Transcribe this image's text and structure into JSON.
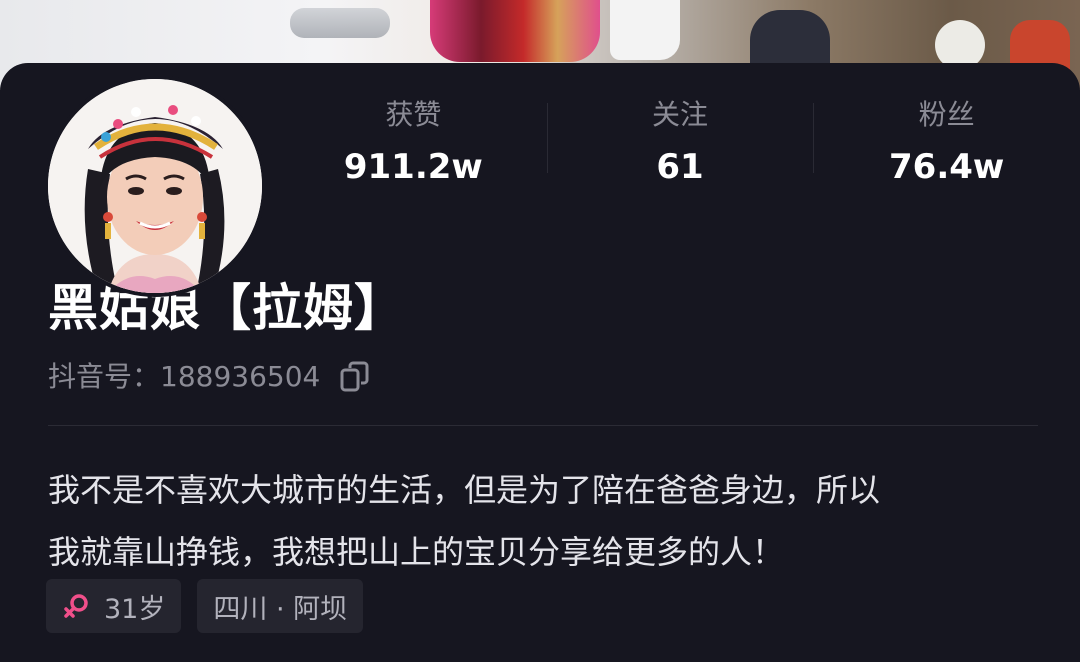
{
  "profile": {
    "name": "黑姑娘【拉姆】",
    "account_label": "抖音号：",
    "account_id": "188936504",
    "bio": "我不是不喜欢大城市的生活，但是为了陪在爸爸身边，所以我就靠山挣钱，我想把山上的宝贝分享给更多的人！",
    "bio_line1": "我不是不喜欢大城市的生活，但是为了陪在爸爸身边，所以",
    "bio_line2": "我就靠山挣钱，我想把山上的宝贝分享给更多的人！"
  },
  "stats": [
    {
      "label": "获赞",
      "value": "911.2w"
    },
    {
      "label": "关注",
      "value": "61"
    },
    {
      "label": "粉丝",
      "value": "76.4w"
    }
  ],
  "tags": {
    "age": "31岁",
    "location": "四川 · 阿坝",
    "gender_icon": "female-icon",
    "gender_color": "#f04f8a"
  },
  "icons": {
    "copy": "copy-icon"
  },
  "colors": {
    "background": "#161620",
    "text_primary": "#ffffff",
    "text_secondary": "#8b8b95",
    "tag_background": "#25252f"
  }
}
